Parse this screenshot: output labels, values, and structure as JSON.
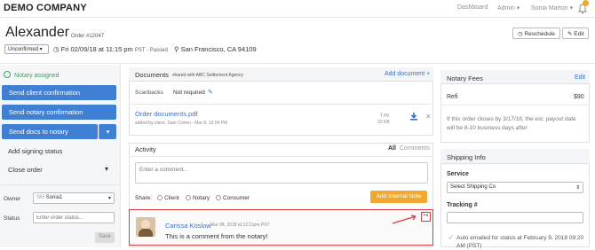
{
  "topbar": {
    "company": "DEMO COMPANY",
    "nav": {
      "dashboard": "Dashboard",
      "admin": "Admin ▾",
      "user": "Sonia Marton ▾"
    }
  },
  "header": {
    "title": "Alexander",
    "order_number": "Order #12047",
    "status": "Unconfirmed",
    "datetime": "Fri 02/09/18 at 11:15 pm",
    "datetime_suffix": "PST - Passed",
    "location": "San Francisco, CA 94109",
    "reschedule": "Reschedule",
    "edit": "Edit"
  },
  "sidebar": {
    "assigned": "Notary assigned",
    "buttons": [
      "Send client confirmation",
      "Send notary confirmation",
      "Send docs to notary"
    ],
    "add_signing_status": "Add signing status",
    "close_order": "Close order",
    "owner_label": "Owner",
    "owner_initials": "SM",
    "owner_value": "Sonia1",
    "status_label": "Status",
    "status_placeholder": "Enter order status...",
    "save": "Save"
  },
  "documents": {
    "title": "Documents",
    "shared": "shared with ABC Settlement Agency",
    "add": "Add document +",
    "scanbacks_label": "Scanbacks",
    "scanbacks_value": "Not required",
    "file_name": "Order documents.pdf",
    "file_meta": "added by client, Sam Cohen - Mar 8, 12:04 PM",
    "pages": "1 pg",
    "size": "33 KB"
  },
  "activity": {
    "title": "Activity",
    "tab_all": "All",
    "tab_comments": "Comments",
    "placeholder": "Enter a comment...",
    "share_label": "Share:",
    "share_options": [
      "Client",
      "Notary",
      "Consumer"
    ],
    "add_internal": "Add Internal Note",
    "comment_author": "Carissa Koslow",
    "comment_time": "Mar 08, 2018 at 12:11pm PST",
    "comment_text": "This is a comment from the notary!"
  },
  "fees": {
    "title": "Notary Fees",
    "edit": "Edit",
    "item": "Refi",
    "amount": "$90",
    "note": "If this order closes by 3/17/18, the est. payout date will be 8-10 business days after"
  },
  "shipping": {
    "title": "Shipping Info",
    "service_label": "Service",
    "service_value": "Select Shipping Co",
    "tracking_label": "Tracking #",
    "auto_email": "Auto emailed for status at February 9, 2018",
    "auto_email_time": "09:20 AM (PST)"
  },
  "colors": {
    "primary": "#3f7fd4",
    "accent": "#f0a830",
    "success": "#3aa35a",
    "highlight": "#e03c3c"
  }
}
